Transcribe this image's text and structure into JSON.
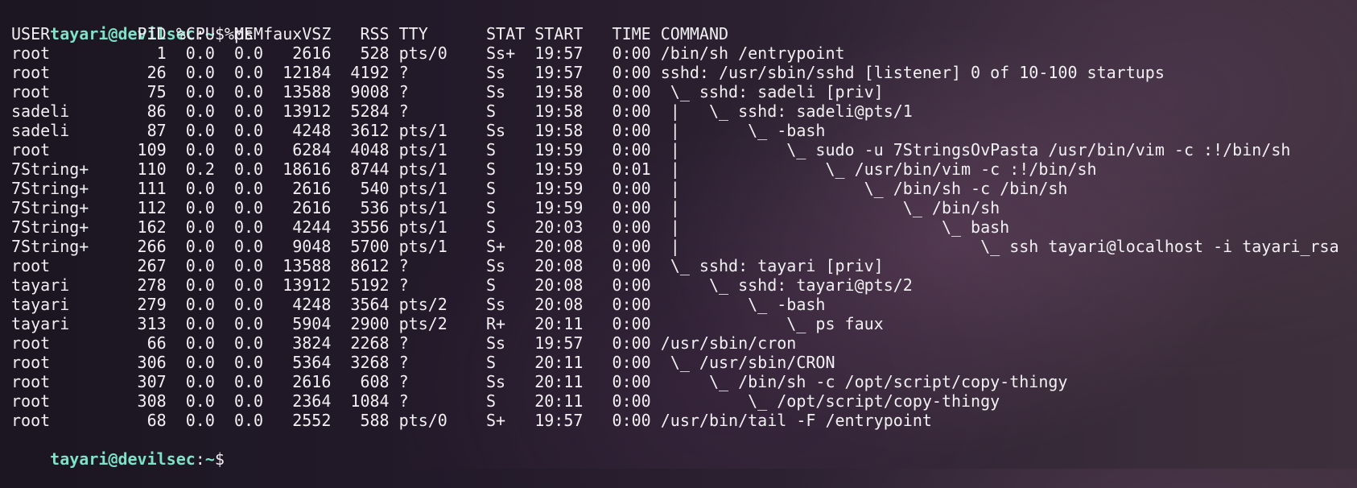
{
  "prompt": {
    "user_host": "tayari@devilsec",
    "separator": ":",
    "path": "~",
    "symbol": "$"
  },
  "command": "ps faux",
  "header": "USER         PID %CPU %MEM    VSZ   RSS TTY      STAT START   TIME COMMAND",
  "rows": [
    "root           1  0.0  0.0   2616   528 pts/0    Ss+  19:57   0:00 /bin/sh /entrypoint",
    "root          26  0.0  0.0  12184  4192 ?        Ss   19:57   0:00 sshd: /usr/sbin/sshd [listener] 0 of 10-100 startups",
    "root          75  0.0  0.0  13588  9008 ?        Ss   19:58   0:00  \\_ sshd: sadeli [priv]",
    "sadeli        86  0.0  0.0  13912  5284 ?        S    19:58   0:00  |   \\_ sshd: sadeli@pts/1",
    "sadeli        87  0.0  0.0   4248  3612 pts/1    Ss   19:58   0:00  |       \\_ -bash",
    "root         109  0.0  0.0   6284  4048 pts/1    S    19:59   0:00  |           \\_ sudo -u 7StringsOvPasta /usr/bin/vim -c :!/bin/sh",
    "7String+     110  0.2  0.0  18616  8744 pts/1    S    19:59   0:01  |               \\_ /usr/bin/vim -c :!/bin/sh",
    "7String+     111  0.0  0.0   2616   540 pts/1    S    19:59   0:00  |                   \\_ /bin/sh -c /bin/sh",
    "7String+     112  0.0  0.0   2616   536 pts/1    S    19:59   0:00  |                       \\_ /bin/sh",
    "7String+     162  0.0  0.0   4244  3556 pts/1    S    20:03   0:00  |                           \\_ bash",
    "7String+     266  0.0  0.0   9048  5700 pts/1    S+   20:08   0:00  |                               \\_ ssh tayari@localhost -i tayari_rsa",
    "root         267  0.0  0.0  13588  8612 ?        Ss   20:08   0:00  \\_ sshd: tayari [priv]",
    "tayari       278  0.0  0.0  13912  5192 ?        S    20:08   0:00      \\_ sshd: tayari@pts/2",
    "tayari       279  0.0  0.0   4248  3564 pts/2    Ss   20:08   0:00          \\_ -bash",
    "tayari       313  0.0  0.0   5904  2900 pts/2    R+   20:11   0:00              \\_ ps faux",
    "root          66  0.0  0.0   3824  2268 ?        Ss   19:57   0:00 /usr/sbin/cron",
    "root         306  0.0  0.0   5364  3268 ?        S    20:11   0:00  \\_ /usr/sbin/CRON",
    "root         307  0.0  0.0   2616   608 ?        Ss   20:11   0:00      \\_ /bin/sh -c /opt/script/copy-thingy",
    "root         308  0.0  0.0   2364  1084 ?        S    20:11   0:00          \\_ /opt/script/copy-thingy",
    "root          68  0.0  0.0   2552   588 pts/0    S+   19:57   0:00 /usr/bin/tail -F /entrypoint"
  ],
  "colors": {
    "prompt_user": "#7ee2c8",
    "text": "#f2f0f3"
  }
}
